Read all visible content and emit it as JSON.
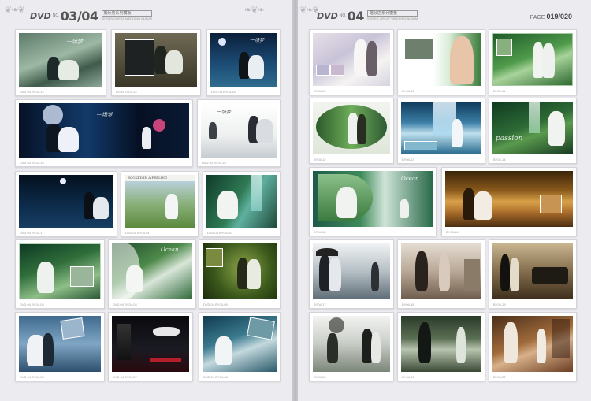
{
  "left_page": {
    "brand": "DVD",
    "number_prefix": "NO.",
    "page_numbers": "03/04",
    "series_title": "婚纱店系列模板",
    "series_en": "SERIES GREAT WEDDING ALBUM"
  },
  "right_page": {
    "brand": "DVD",
    "number_prefix": "NO.",
    "page_numbers": "04",
    "series_title": "婚纱店系列模板",
    "series_en": "SERIES GREAT WEDDING ALBUM",
    "page_label": "PAGE",
    "page_range": "019/020"
  },
  "thumbnails": [
    {
      "code": "DVD 03    BY03-12",
      "overlay": "一场梦"
    },
    {
      "code": "BY03    BY03-13",
      "overlay": ""
    },
    {
      "code": "DVD 03    BY03-14",
      "overlay": "一场梦"
    },
    {
      "code": "DVD 03    BY03-15",
      "overlay": "一场梦"
    },
    {
      "code": "DVD 03    BY03-16",
      "overlay": "一场梦"
    },
    {
      "code": "DVD 03    BY03-17",
      "overlay": ""
    },
    {
      "code": "DVD 04    BY04-01",
      "overlay": "BOOKED IN A FEELING"
    },
    {
      "code": "DVD 04    BY04-02",
      "overlay": ""
    },
    {
      "code": "DVD 04    BY04-03",
      "overlay": ""
    },
    {
      "code": "DVD 04    BY04-04",
      "overlay": "Ocean"
    },
    {
      "code": "DVD 04    BY04-05",
      "overlay": ""
    },
    {
      "code": "DVD 04    BY04-06",
      "overlay": ""
    },
    {
      "code": "DVD 04    BY04-07",
      "overlay": ""
    },
    {
      "code": "DVD 04    BY04-08",
      "overlay": ""
    },
    {
      "code": "BY04-09",
      "overlay": ""
    },
    {
      "code": "BY04-10",
      "overlay": ""
    },
    {
      "code": "BY04-11",
      "overlay": ""
    },
    {
      "code": "BY04-12",
      "overlay": ""
    },
    {
      "code": "BY04-13",
      "overlay": ""
    },
    {
      "code": "BY04-14",
      "overlay": "passion"
    },
    {
      "code": "BY04-15",
      "overlay": "Ocean"
    },
    {
      "code": "BY04-16",
      "overlay": ""
    },
    {
      "code": "BY04-17",
      "overlay": ""
    },
    {
      "code": "BY04-18",
      "overlay": ""
    },
    {
      "code": "BY04-19",
      "overlay": ""
    },
    {
      "code": "BY04-20",
      "overlay": ""
    },
    {
      "code": "BY04-21",
      "overlay": ""
    },
    {
      "code": "BY04-22",
      "overlay": ""
    }
  ],
  "colors": {
    "page_bg": "#ececf0",
    "card_bg": "#ffffff",
    "header_text": "#555555"
  }
}
